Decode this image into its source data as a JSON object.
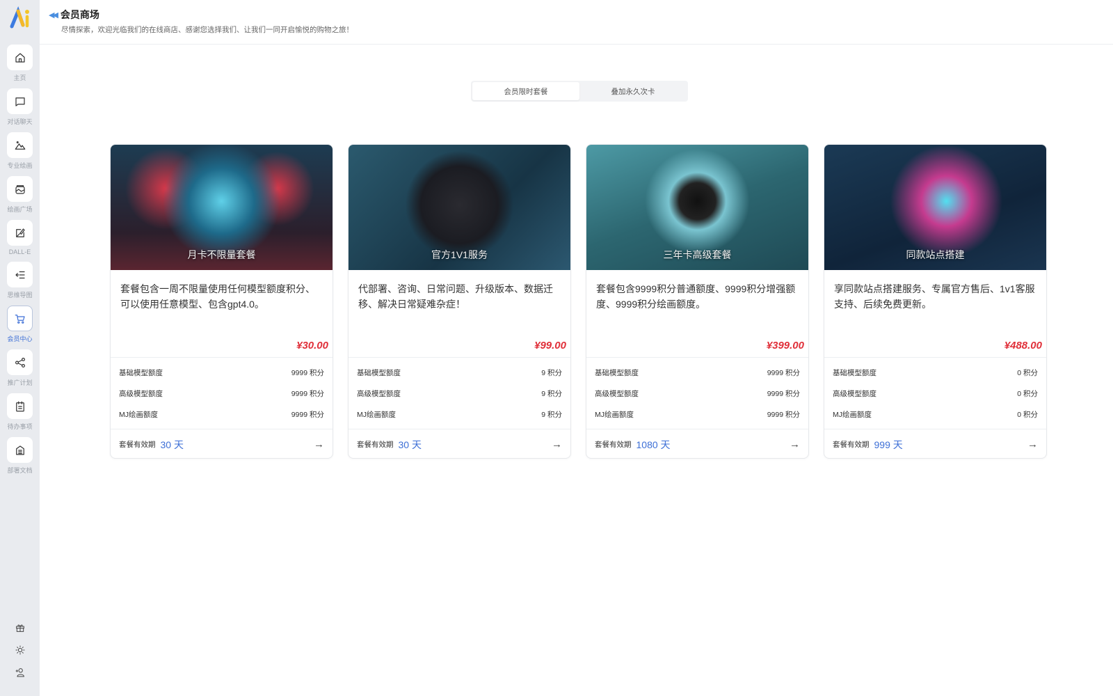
{
  "sidebar": {
    "logo": "Ai",
    "items": [
      {
        "label": "主页",
        "icon": "home-icon"
      },
      {
        "label": "对话聊天",
        "icon": "chat-icon"
      },
      {
        "label": "专业绘画",
        "icon": "mountain-icon"
      },
      {
        "label": "绘画广场",
        "icon": "gallery-icon"
      },
      {
        "label": "DALL-E",
        "icon": "image-edit-icon"
      },
      {
        "label": "思维导图",
        "icon": "mindmap-icon"
      },
      {
        "label": "会员中心",
        "icon": "cart-icon",
        "active": true
      },
      {
        "label": "推广计划",
        "icon": "share-icon"
      },
      {
        "label": "待办事项",
        "icon": "clipboard-icon"
      },
      {
        "label": "部署文档",
        "icon": "document-icon"
      }
    ],
    "bottom": [
      "gift-icon",
      "sun-icon",
      "add-user-icon"
    ]
  },
  "header": {
    "title": "会员商场",
    "subtitle": "尽情探索，欢迎光临我们的在线商店、感谢您选择我们、让我们一同开启愉悦的购物之旅！"
  },
  "tabs": [
    {
      "label": "会员限时套餐",
      "active": true
    },
    {
      "label": "叠加永久次卡",
      "active": false
    }
  ],
  "labels": {
    "basic": "基础模型额度",
    "advanced": "高级模型额度",
    "mj": "MJ绘画额度",
    "validity": "套餐有效期",
    "unit": "积分",
    "day_unit": "天"
  },
  "accent_color": "#3d6fd6",
  "price_color": "#e0303a",
  "cards": [
    {
      "image_title": "月卡不限量套餐",
      "description": "套餐包含一周不限量使用任何模型额度积分、可以使用任意模型、包含gpt4.0。",
      "price": "¥30.00",
      "basic": "9999 积分",
      "advanced": "9999 积分",
      "mj": "9999 积分",
      "days": "30 天"
    },
    {
      "image_title": "官方1V1服务",
      "description": "代部署、咨询、日常问题、升级版本、数据迁移、解决日常疑难杂症！",
      "price": "¥99.00",
      "basic": "9 积分",
      "advanced": "9 积分",
      "mj": "9 积分",
      "days": "30 天"
    },
    {
      "image_title": "三年卡高级套餐",
      "description": "套餐包含9999积分普通额度、9999积分增强额度、9999积分绘画额度。",
      "price": "¥399.00",
      "basic": "9999 积分",
      "advanced": "9999 积分",
      "mj": "9999 积分",
      "days": "1080 天"
    },
    {
      "image_title": "同款站点搭建",
      "description": "享同款站点搭建服务、专属官方售后、1v1客服支持、后续免费更新。",
      "price": "¥488.00",
      "basic": "0 积分",
      "advanced": "0 积分",
      "mj": "0 积分",
      "days": "999 天"
    }
  ]
}
